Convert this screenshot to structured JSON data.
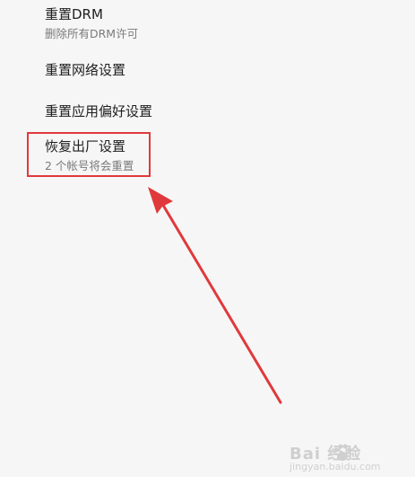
{
  "settings": {
    "items": [
      {
        "title": "重置DRM",
        "subtitle": "删除所有DRM许可"
      },
      {
        "title": "重置网络设置"
      },
      {
        "title": "重置应用偏好设置"
      },
      {
        "title": "恢复出厂设置",
        "subtitle": "2 个帐号将会重置"
      }
    ]
  },
  "annotation": {
    "highlight_color": "#e0393c"
  },
  "watermark": {
    "text": "Bai 经验",
    "sub": "jingyan.baidu.com"
  }
}
